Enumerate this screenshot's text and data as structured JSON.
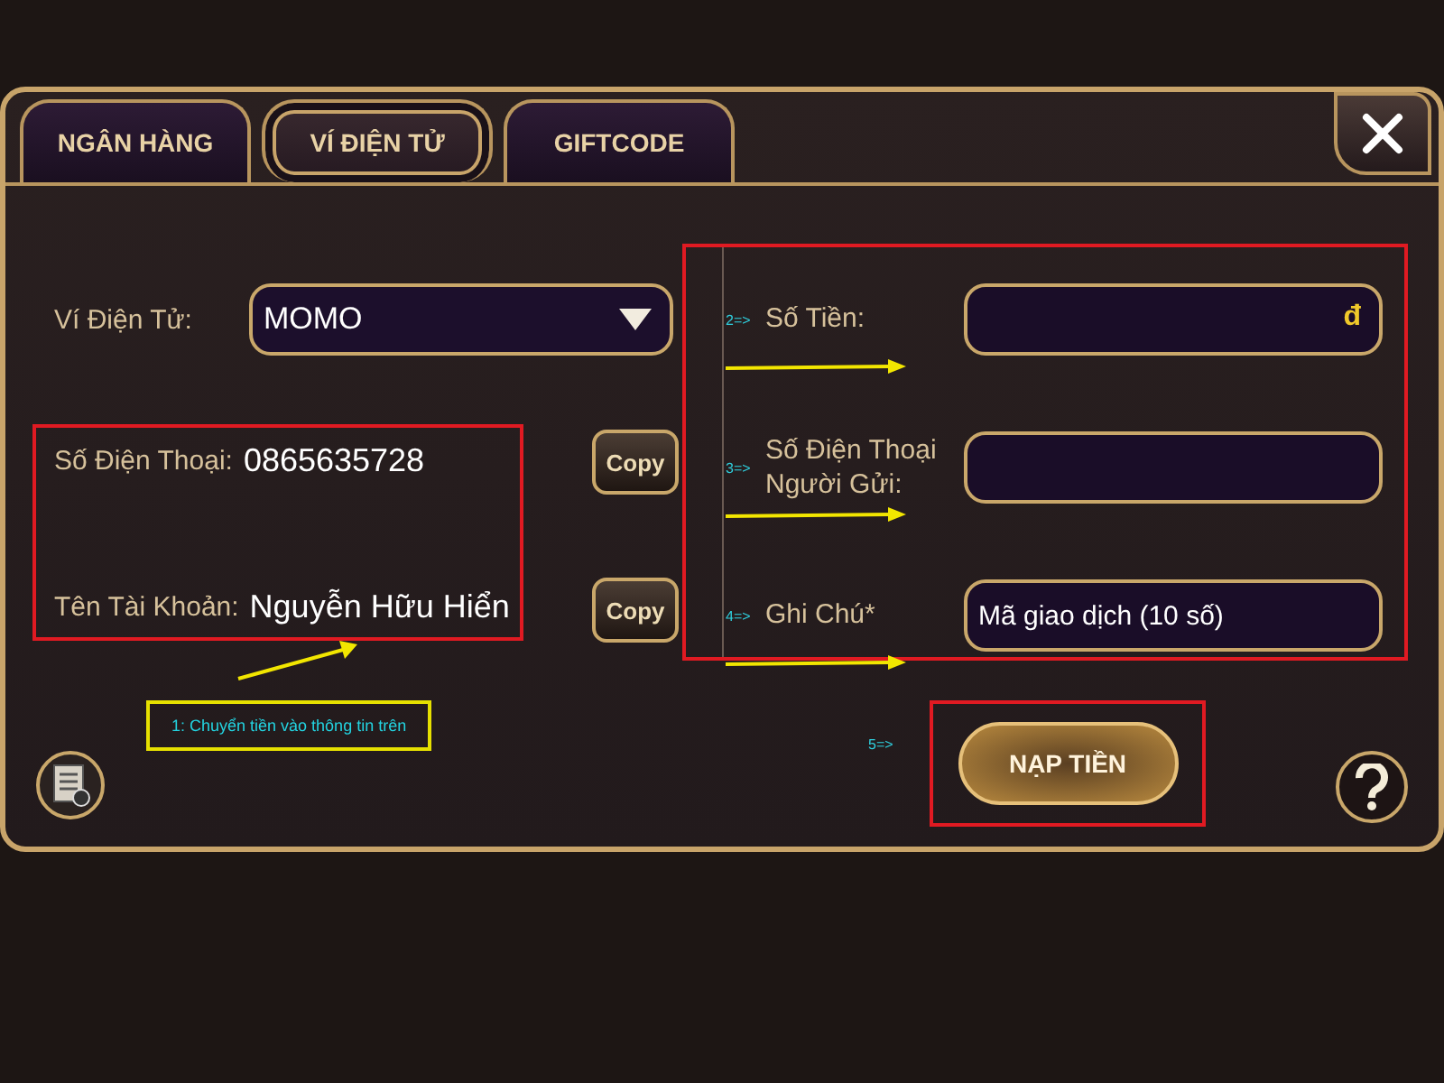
{
  "tabs": [
    {
      "label": "NGÂN HÀNG",
      "selected": false
    },
    {
      "label": "VÍ ĐIỆN TỬ",
      "selected": true
    },
    {
      "label": "GIFTCODE",
      "selected": false
    }
  ],
  "wallet": {
    "label": "Ví Điện Tử:",
    "value": "MOMO"
  },
  "recipient": [
    {
      "label": "Số Điện Thoại:",
      "value": "0865635728",
      "button": "Copy"
    },
    {
      "label": "Tên Tài Khoản:",
      "value": "Nguyễn Hữu Hiển",
      "button": "Copy"
    }
  ],
  "annotation": "1: Chuyển tiền vào thông tin trên",
  "form": [
    {
      "step": "2=>",
      "label": "Số Tiền:",
      "suffix": "đ"
    },
    {
      "step": "3=>",
      "label": "Số Điện Thoại Người Gửi:"
    },
    {
      "step": "4=>",
      "label": "Ghi Chú*",
      "placeholder": "Mã giao dịch (10 số)"
    }
  ],
  "submit": {
    "step": "5=>",
    "label": "NẠP TIỀN"
  }
}
